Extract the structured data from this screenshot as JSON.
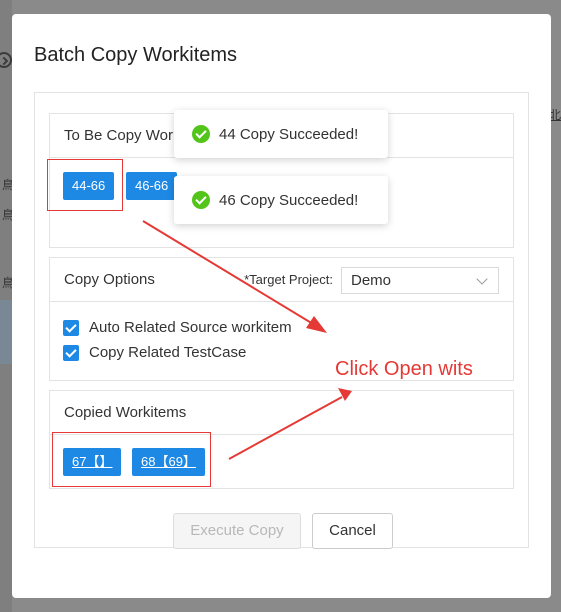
{
  "background": {
    "left_glyphs": [
      "鳥",
      "鳥",
      "鳥"
    ],
    "right_glyph": "北"
  },
  "modal": {
    "title": "Batch Copy Workitems"
  },
  "to_be_copy": {
    "heading": "To Be Copy Wor",
    "items": [
      "44-66",
      "46-66"
    ]
  },
  "toasts": [
    {
      "icon": "check-circle-icon",
      "text": "44 Copy Succeeded!"
    },
    {
      "icon": "check-circle-icon",
      "text": "46 Copy Succeeded!"
    }
  ],
  "copy_options": {
    "heading": "Copy Options",
    "target_label": "*Target Project:",
    "target_value": "Demo",
    "options": [
      {
        "label": "Auto Related Source workitem",
        "checked": true
      },
      {
        "label": "Copy Related TestCase",
        "checked": true
      }
    ]
  },
  "copied": {
    "heading": "Copied Workitems",
    "items": [
      "67【】",
      "68【69】"
    ]
  },
  "buttons": {
    "execute": "Execute Copy",
    "cancel": "Cancel"
  },
  "annotation": {
    "text": "Click Open wits",
    "color": "#e53935"
  },
  "colors": {
    "primary": "#1e88e5",
    "success": "#52c41a",
    "annotation": "#e53935"
  }
}
